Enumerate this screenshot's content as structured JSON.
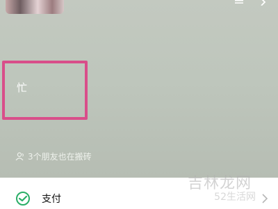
{
  "profile": {
    "status_text": "忙",
    "friends_text": "3个朋友也在搬砖"
  },
  "menu": {
    "pay_label": "支付"
  },
  "watermark": {
    "main": "吉林龙网",
    "sub": "52生活网"
  },
  "icons": {
    "more": "more-icon",
    "arrow": "chevron-right-icon",
    "friends": "friends-icon",
    "pay": "pay-icon"
  },
  "colors": {
    "highlight": "#d94e8a",
    "pay_green": "#2aae67",
    "header_bg": "#bec6bc"
  }
}
